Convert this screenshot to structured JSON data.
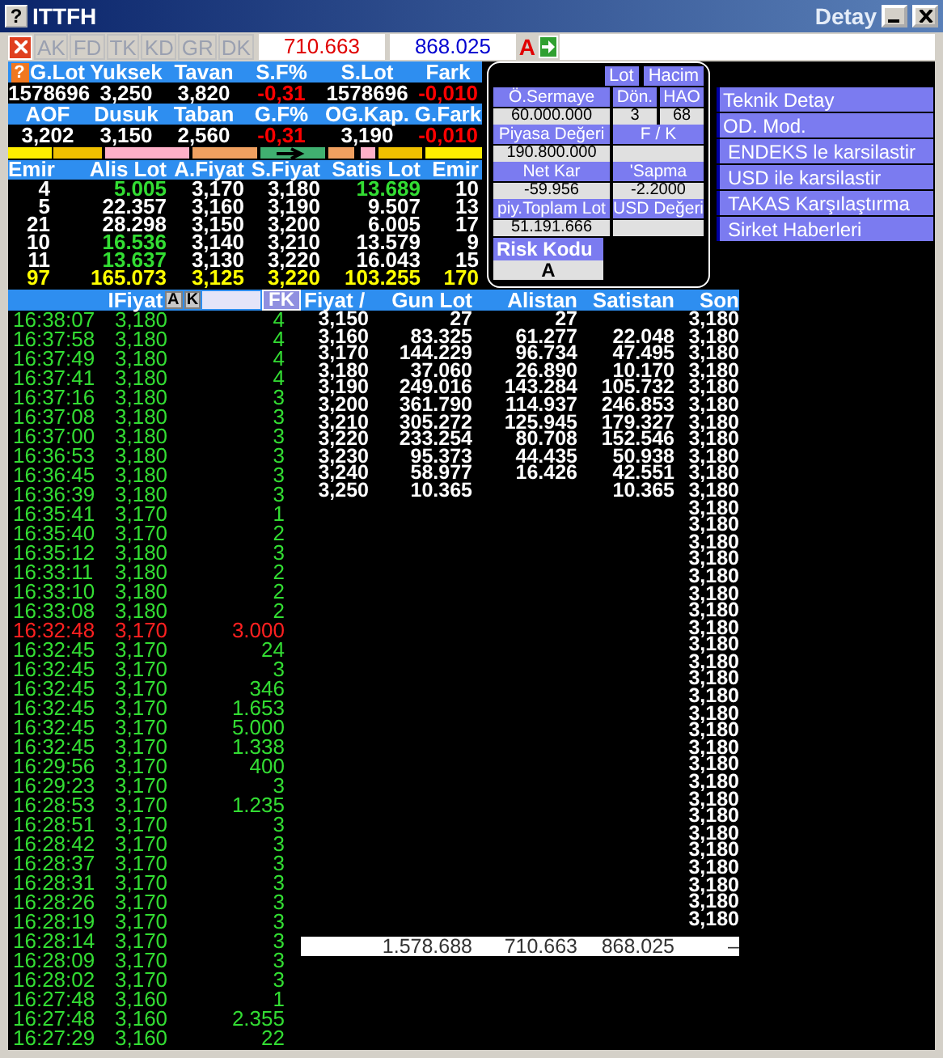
{
  "window": {
    "help_button": "?",
    "title": "ITTFH",
    "subtitle": "Detay"
  },
  "toolbar": {
    "buttons": [
      {
        "label": "AK",
        "disabled": true
      },
      {
        "label": "FD",
        "disabled": true
      },
      {
        "label": "TK",
        "disabled": true
      },
      {
        "label": "KD",
        "disabled": true
      },
      {
        "label": "GR",
        "disabled": true
      },
      {
        "label": "DK",
        "disabled": true
      }
    ],
    "values": [
      {
        "text": "710.663",
        "color": "#e00000"
      },
      {
        "text": "868.025",
        "color": "#0000d0"
      }
    ],
    "marker": "A"
  },
  "stats_help_button": "?",
  "stats_rows": [
    [
      {
        "header": "G.Lot",
        "value": "1578696",
        "color": "#ffffff"
      },
      {
        "header": "Yuksek",
        "value": "3,250",
        "color": "#ffffff"
      },
      {
        "header": "Tavan",
        "value": "3,820",
        "color": "#ffffff"
      },
      {
        "header": "S.F%",
        "value": "-0,31",
        "color": "#ff0000"
      },
      {
        "header": "S.Lot",
        "value": "1578696",
        "color": "#ffffff"
      },
      {
        "header": "Fark",
        "value": "-0,010",
        "color": "#ff0000"
      }
    ],
    [
      {
        "header": "AOF",
        "value": "3,202",
        "color": "#ffffff"
      },
      {
        "header": "Dusuk",
        "value": "3,150",
        "color": "#ffffff"
      },
      {
        "header": "Taban",
        "value": "2,560",
        "color": "#ffffff"
      },
      {
        "header": "G.F%",
        "value": "-0,31",
        "color": "#ff0000"
      },
      {
        "header": "OG.Kap.",
        "value": "3,190",
        "color": "#ffffff"
      },
      {
        "header": "G.Fark",
        "value": "-0,010",
        "color": "#ff0000"
      }
    ]
  ],
  "order_book": {
    "columns": [
      "Emir",
      "Alis Lot",
      "A.Fiyat",
      "S.Fiyat",
      "Satis Lot",
      "Emir"
    ],
    "rows": [
      {
        "cells": [
          {
            "text": "4",
            "color": "#ffffff"
          },
          {
            "text": "5.005",
            "color": "#33dd33"
          },
          {
            "text": "3,170",
            "color": "#ffffff"
          },
          {
            "text": "3,180",
            "color": "#ffffff"
          },
          {
            "text": "13.689",
            "color": "#33dd33"
          },
          {
            "text": "10",
            "color": "#ffffff"
          }
        ]
      },
      {
        "cells": [
          {
            "text": "5",
            "color": "#ffffff"
          },
          {
            "text": "22.357",
            "color": "#ffffff"
          },
          {
            "text": "3,160",
            "color": "#ffffff"
          },
          {
            "text": "3,190",
            "color": "#ffffff"
          },
          {
            "text": "9.507",
            "color": "#ffffff"
          },
          {
            "text": "13",
            "color": "#ffffff"
          }
        ]
      },
      {
        "cells": [
          {
            "text": "21",
            "color": "#ffffff"
          },
          {
            "text": "28.298",
            "color": "#ffffff"
          },
          {
            "text": "3,150",
            "color": "#ffffff"
          },
          {
            "text": "3,200",
            "color": "#ffffff"
          },
          {
            "text": "6.005",
            "color": "#ffffff"
          },
          {
            "text": "17",
            "color": "#ffffff"
          }
        ]
      },
      {
        "cells": [
          {
            "text": "10",
            "color": "#ffffff"
          },
          {
            "text": "16.536",
            "color": "#33dd33"
          },
          {
            "text": "3,140",
            "color": "#ffffff"
          },
          {
            "text": "3,210",
            "color": "#ffffff"
          },
          {
            "text": "13.579",
            "color": "#ffffff"
          },
          {
            "text": "9",
            "color": "#ffffff"
          }
        ]
      },
      {
        "cells": [
          {
            "text": "11",
            "color": "#ffffff"
          },
          {
            "text": "13.637",
            "color": "#33dd33"
          },
          {
            "text": "3,130",
            "color": "#ffffff"
          },
          {
            "text": "3,220",
            "color": "#ffffff"
          },
          {
            "text": "16.043",
            "color": "#ffffff"
          },
          {
            "text": "15",
            "color": "#ffffff"
          }
        ]
      },
      {
        "cells": [
          {
            "text": "97",
            "color": "#ffff00"
          },
          {
            "text": "165.073",
            "color": "#ffff00"
          },
          {
            "text": "3,125",
            "color": "#ffff00"
          },
          {
            "text": "3,220",
            "color": "#ffff00"
          },
          {
            "text": "103.255",
            "color": "#ffff00"
          },
          {
            "text": "170",
            "color": "#ffff00"
          }
        ]
      }
    ]
  },
  "panel": {
    "buttons": [
      {
        "label": "Lot"
      },
      {
        "label": "Hacim"
      }
    ],
    "rows": [
      [
        {
          "label": "Ö.Sermaye",
          "value": "60.000.000"
        },
        {
          "label": "Dön.",
          "value": "3"
        },
        {
          "label": "HAO",
          "value": "68"
        }
      ],
      [
        {
          "label": "Piyasa Değeri",
          "value": "190.800.000"
        },
        {
          "label": "F / K"
        }
      ],
      [
        {
          "label": "Net Kar",
          "value": "-59.956"
        },
        {
          "label": "'Sapma",
          "value": "-2.2000"
        }
      ],
      [
        {
          "label": "piy.Toplam Lot",
          "value": "51.191.666"
        },
        {
          "label": "USD Değeri"
        }
      ]
    ],
    "risk": {
      "label": "Risk Kodu",
      "value": "A"
    }
  },
  "menu": [
    "Teknik Detay",
    "OD. Mod.",
    "ENDEKS le karsilastir",
    "USD ile karsilastir",
    "TAKAS Karşılaştırma",
    "Sirket Haberleri"
  ],
  "trades_header": {
    "label": "IFiyat",
    "buttons": [
      "A",
      "K"
    ],
    "fk_button": "FK"
  },
  "trades": [
    {
      "time": "16:38:07",
      "price": "3,180",
      "lot": "4",
      "color": "#33dd33"
    },
    {
      "time": "16:37:58",
      "price": "3,180",
      "lot": "4",
      "color": "#33dd33"
    },
    {
      "time": "16:37:49",
      "price": "3,180",
      "lot": "4",
      "color": "#33dd33"
    },
    {
      "time": "16:37:41",
      "price": "3,180",
      "lot": "4",
      "color": "#33dd33"
    },
    {
      "time": "16:37:16",
      "price": "3,180",
      "lot": "3",
      "color": "#33dd33"
    },
    {
      "time": "16:37:08",
      "price": "3,180",
      "lot": "3",
      "color": "#33dd33"
    },
    {
      "time": "16:37:00",
      "price": "3,180",
      "lot": "3",
      "color": "#33dd33"
    },
    {
      "time": "16:36:53",
      "price": "3,180",
      "lot": "3",
      "color": "#33dd33"
    },
    {
      "time": "16:36:45",
      "price": "3,180",
      "lot": "3",
      "color": "#33dd33"
    },
    {
      "time": "16:36:39",
      "price": "3,180",
      "lot": "3",
      "color": "#33dd33"
    },
    {
      "time": "16:35:41",
      "price": "3,170",
      "lot": "1",
      "color": "#33dd33"
    },
    {
      "time": "16:35:40",
      "price": "3,170",
      "lot": "2",
      "color": "#33dd33"
    },
    {
      "time": "16:35:12",
      "price": "3,180",
      "lot": "3",
      "color": "#33dd33"
    },
    {
      "time": "16:33:11",
      "price": "3,180",
      "lot": "2",
      "color": "#33dd33"
    },
    {
      "time": "16:33:10",
      "price": "3,180",
      "lot": "2",
      "color": "#33dd33"
    },
    {
      "time": "16:33:08",
      "price": "3,180",
      "lot": "2",
      "color": "#33dd33"
    },
    {
      "time": "16:32:48",
      "price": "3,170",
      "lot": "3.000",
      "color": "#ff2020"
    },
    {
      "time": "16:32:45",
      "price": "3,170",
      "lot": "24",
      "color": "#33dd33"
    },
    {
      "time": "16:32:45",
      "price": "3,170",
      "lot": "3",
      "color": "#33dd33"
    },
    {
      "time": "16:32:45",
      "price": "3,170",
      "lot": "346",
      "color": "#33dd33"
    },
    {
      "time": "16:32:45",
      "price": "3,170",
      "lot": "1.653",
      "color": "#33dd33"
    },
    {
      "time": "16:32:45",
      "price": "3,170",
      "lot": "5.000",
      "color": "#33dd33"
    },
    {
      "time": "16:32:45",
      "price": "3,170",
      "lot": "1.338",
      "color": "#33dd33"
    },
    {
      "time": "16:29:56",
      "price": "3,170",
      "lot": "400",
      "color": "#33dd33"
    },
    {
      "time": "16:29:23",
      "price": "3,170",
      "lot": "3",
      "color": "#33dd33"
    },
    {
      "time": "16:28:53",
      "price": "3,170",
      "lot": "1.235",
      "color": "#33dd33"
    },
    {
      "time": "16:28:51",
      "price": "3,170",
      "lot": "3",
      "color": "#33dd33"
    },
    {
      "time": "16:28:42",
      "price": "3,170",
      "lot": "3",
      "color": "#33dd33"
    },
    {
      "time": "16:28:37",
      "price": "3,170",
      "lot": "3",
      "color": "#33dd33"
    },
    {
      "time": "16:28:31",
      "price": "3,170",
      "lot": "3",
      "color": "#33dd33"
    },
    {
      "time": "16:28:26",
      "price": "3,170",
      "lot": "3",
      "color": "#33dd33"
    },
    {
      "time": "16:28:19",
      "price": "3,170",
      "lot": "3",
      "color": "#33dd33"
    },
    {
      "time": "16:28:14",
      "price": "3,170",
      "lot": "3",
      "color": "#33dd33"
    },
    {
      "time": "16:28:09",
      "price": "3,170",
      "lot": "3",
      "color": "#33dd33"
    },
    {
      "time": "16:28:02",
      "price": "3,170",
      "lot": "3",
      "color": "#33dd33"
    },
    {
      "time": "16:27:48",
      "price": "3,160",
      "lot": "1",
      "color": "#33dd33"
    },
    {
      "time": "16:27:48",
      "price": "3,160",
      "lot": "2.355",
      "color": "#33dd33"
    },
    {
      "time": "16:27:29",
      "price": "3,160",
      "lot": "22",
      "color": "#33dd33"
    }
  ],
  "price_table": {
    "columns": [
      "Fiyat /",
      "Gun Lot",
      "Alistan",
      "Satistan",
      "Son"
    ],
    "rows": [
      [
        "3,150",
        "27",
        "27",
        ""
      ],
      [
        "3,160",
        "83.325",
        "61.277",
        "22.048"
      ],
      [
        "3,170",
        "144.229",
        "96.734",
        "47.495"
      ],
      [
        "3,180",
        "37.060",
        "26.890",
        "10.170"
      ],
      [
        "3,190",
        "249.016",
        "143.284",
        "105.732"
      ],
      [
        "3,200",
        "361.790",
        "114.937",
        "246.853"
      ],
      [
        "3,210",
        "305.272",
        "125.945",
        "179.327"
      ],
      [
        "3,220",
        "233.254",
        "80.708",
        "152.546"
      ],
      [
        "3,230",
        "95.373",
        "44.435",
        "50.938"
      ],
      [
        "3,240",
        "58.977",
        "16.426",
        "42.551"
      ],
      [
        "3,250",
        "10.365",
        "",
        "10.365"
      ]
    ],
    "son": [
      "3,180",
      "3,180",
      "3,180",
      "3,180",
      "3,180",
      "3,180",
      "3,180",
      "3,180",
      "3,180",
      "3,180",
      "3,180",
      "3,180",
      "3,180",
      "3,180",
      "3,180",
      "3,180",
      "3,180",
      "3,180",
      "3,180",
      "3,180",
      "3,180",
      "3,180",
      "3,180",
      "3,180",
      "3,180",
      "3,180",
      "3,180",
      "3,180",
      "3,180",
      "3,180",
      "3,180",
      "3,180",
      "3,180",
      "3,180",
      "3,180",
      "3,180"
    ],
    "totals": [
      "1.578.688",
      "710.663",
      "868.025",
      "–"
    ]
  }
}
